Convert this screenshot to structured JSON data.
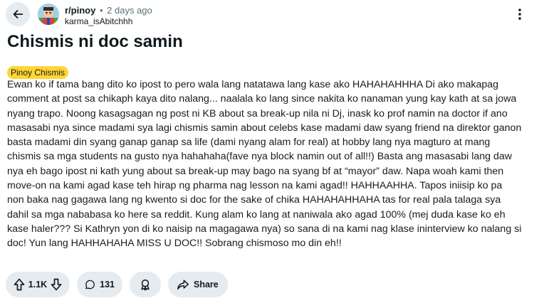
{
  "header": {
    "subreddit": "r/pinoy",
    "dot": "•",
    "time": "2 days ago",
    "username": "karma_isAbitchhh"
  },
  "post": {
    "title": "Chismis ni doc samin",
    "flair": "Pinoy Chismis",
    "lines": [
      "Ewan ko if tama bang dito ko ipost to pero wala lang natatawa lang kase ako HAHAHAHHHA Di ako makapag",
      "comment at post sa chikaph kaya dito nalang... naalala ko lang since nakita ko nanaman yung kay kath at sa jowa",
      "nyang trapo. Noong kasagsagan ng post ni KB about sa break-up nila ni Dj, inask ko prof namin na doctor if ano",
      "masasabi nya since madami sya lagi chismis samin about celebs kase madami daw syang friend na direktor ganon",
      "basta madami din syang ganap ganap sa life (dami nyang alam for real) at hobby lang nya magturo at mang",
      "chismis sa mga students na gusto nya hahahaha(fave nya block namin out of all!!) Basta ang masasabi lang daw",
      "nya eh bago ipost ni kath yung about sa break-up may bago na syang bf at “mayor” daw. Napa woah kami then",
      "move-on na kami agad kase teh hirap ng pharma nag lesson na kami agad!! HAHHAAHHA. Tapos iniisip ko pa",
      "non baka nag gagawa lang ng kwento si doc for the sake of chika HAHAHAHHAHA tas for real pala talaga sya",
      "dahil sa mga nababasa ko here sa reddit. Kung alam ko lang at naniwala ako agad 100% (mej duda kase ko eh",
      "kase haler??? Si Kathryn yon di ko naisip na magagawa nya) so sana di na kami nag klase ininterview ko nalang si",
      "doc! Yun lang HAHHAHAHA MISS U DOC!! Sobrang chismoso mo din eh!!"
    ]
  },
  "actions": {
    "upvotes": "1.1K",
    "comments": "131",
    "share_label": "Share"
  },
  "icons": {
    "back": "arrow-left-icon",
    "more": "more-vertical-icon",
    "upvote": "arrow-up-icon",
    "downvote": "arrow-down-icon",
    "comment": "comment-bubble-icon",
    "award": "award-icon",
    "share": "share-arrow-icon"
  },
  "colors": {
    "flair_bg": "#ffd635",
    "pill_bg": "#e5ebee",
    "meta_text": "#576f76"
  }
}
